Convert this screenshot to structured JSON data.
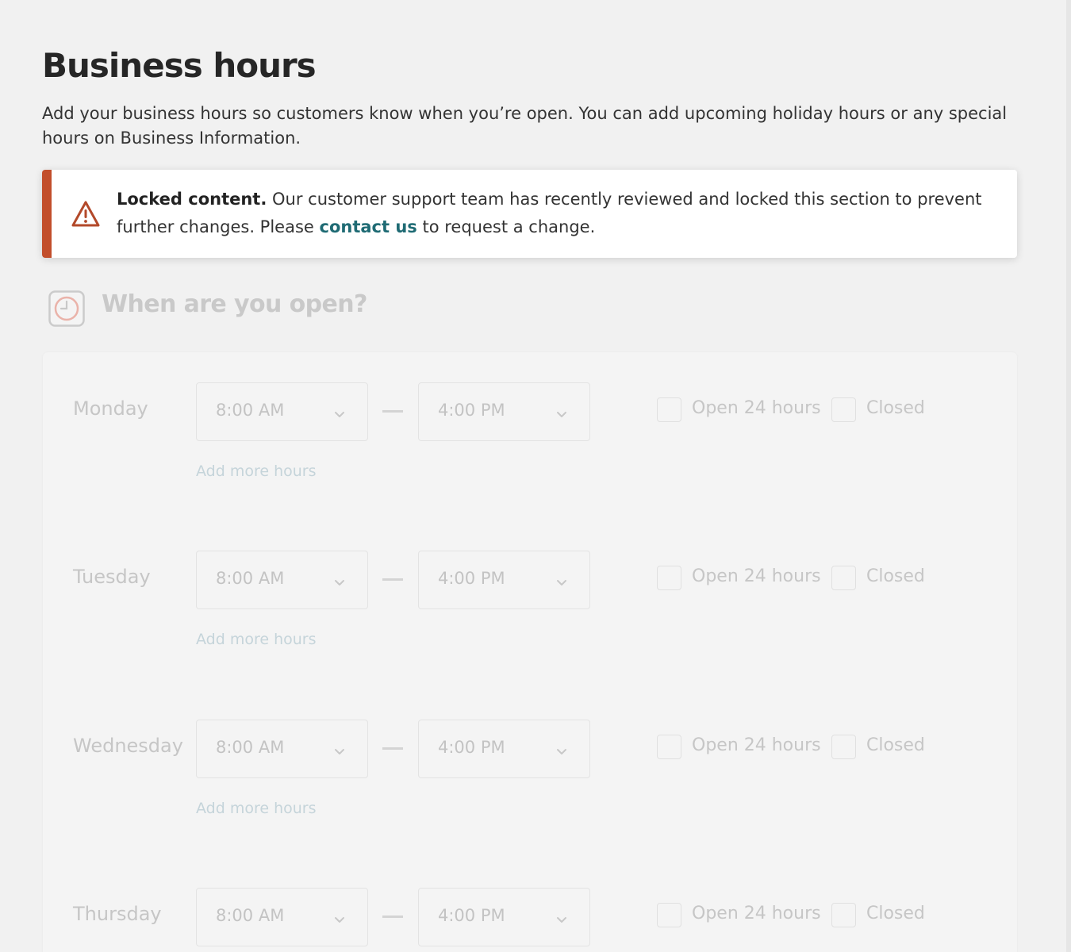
{
  "header": {
    "title": "Business hours",
    "subtitle": "Add your business hours so customers know when you’re open. You can add upcoming holiday hours or any special hours on Business Information."
  },
  "alert": {
    "icon": "warning-triangle-icon",
    "bold": "Locked content.",
    "text_before_link": " Our customer support team has recently reviewed and locked this section to prevent further changes. Please ",
    "link": "contact us",
    "text_after_link": " to request a change.",
    "accent_color": "#c24e2b",
    "link_color": "#1f6b74"
  },
  "section": {
    "icon": "clock-icon",
    "title": "When are you open?"
  },
  "labels": {
    "open24": "Open 24 hours",
    "closed": "Closed",
    "add_more": "Add more hours"
  },
  "days": [
    {
      "name": "Monday",
      "open": "8:00 AM",
      "close": "4:00 PM"
    },
    {
      "name": "Tuesday",
      "open": "8:00 AM",
      "close": "4:00 PM"
    },
    {
      "name": "Wednesday",
      "open": "8:00 AM",
      "close": "4:00 PM"
    },
    {
      "name": "Thursday",
      "open": "8:00 AM",
      "close": "4:00 PM"
    }
  ]
}
